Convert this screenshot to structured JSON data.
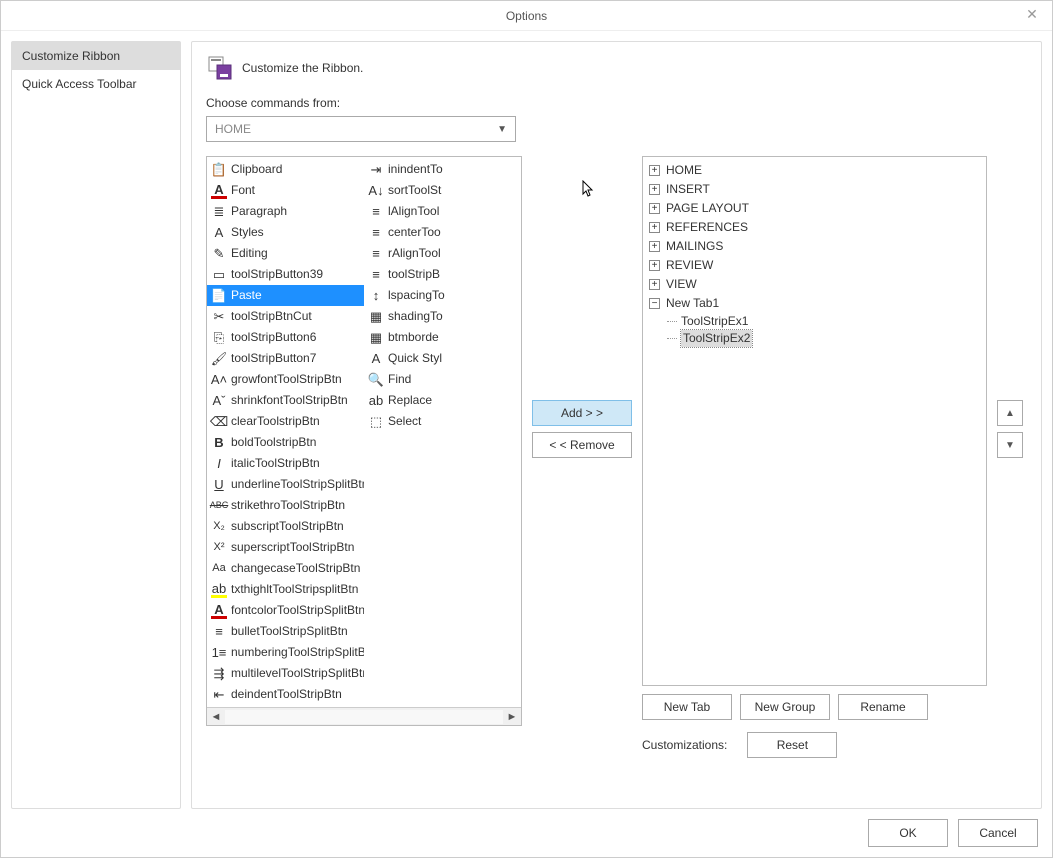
{
  "window": {
    "title": "Options"
  },
  "sidebar": {
    "items": [
      {
        "label": "Customize Ribbon",
        "selected": true
      },
      {
        "label": "Quick Access Toolbar",
        "selected": false
      }
    ]
  },
  "header": {
    "title": "Customize the Ribbon."
  },
  "choose_label": "Choose commands from:",
  "dropdown": {
    "value": "HOME"
  },
  "commands_left": [
    {
      "label": "Clipboard",
      "icon": "clipboard-icon",
      "glyph": "📋"
    },
    {
      "label": "Font",
      "icon": "font-icon",
      "glyph": "A"
    },
    {
      "label": "Paragraph",
      "icon": "paragraph-icon",
      "glyph": "≣"
    },
    {
      "label": "Styles",
      "icon": "styles-icon",
      "glyph": "A"
    },
    {
      "label": "Editing",
      "icon": "editing-icon",
      "glyph": "✎"
    },
    {
      "label": "toolStripButton39",
      "icon": "button-icon",
      "glyph": "▭"
    },
    {
      "label": "Paste",
      "icon": "paste-icon",
      "glyph": "📄",
      "selected": true
    },
    {
      "label": "toolStripBtnCut",
      "icon": "cut-icon",
      "glyph": "✂"
    },
    {
      "label": "toolStripButton6",
      "icon": "copy-icon",
      "glyph": "⎘"
    },
    {
      "label": "toolStripButton7",
      "icon": "brush-icon",
      "glyph": "🖌"
    },
    {
      "label": "growfontToolStripBtn",
      "icon": "growfont-icon",
      "glyph": "A˄"
    },
    {
      "label": "shrinkfontToolStripBtn",
      "icon": "shrinkfont-icon",
      "glyph": "Aˇ"
    },
    {
      "label": "clearToolstripBtn",
      "icon": "clear-icon",
      "glyph": "⌫"
    },
    {
      "label": "boldToolstripBtn",
      "icon": "bold-icon",
      "glyph": "B"
    },
    {
      "label": "italicToolStripBtn",
      "icon": "italic-icon",
      "glyph": "I"
    },
    {
      "label": "underlineToolStripSplitBtn",
      "icon": "underline-icon",
      "glyph": "U"
    },
    {
      "label": "strikethroToolStripBtn",
      "icon": "strike-icon",
      "glyph": "ABC"
    },
    {
      "label": "subscriptToolStripBtn",
      "icon": "subscript-icon",
      "glyph": "X₂"
    },
    {
      "label": "superscriptToolStripBtn",
      "icon": "superscript-icon",
      "glyph": "X²"
    },
    {
      "label": "changecaseToolStripBtn",
      "icon": "changecase-icon",
      "glyph": "Aa"
    },
    {
      "label": "txthighltToolStripsplitBtn",
      "icon": "highlight-icon",
      "glyph": "ab"
    },
    {
      "label": "fontcolorToolStripSplitBtn",
      "icon": "fontcolor-icon",
      "glyph": "A"
    },
    {
      "label": "bulletToolStripSplitBtn",
      "icon": "bullet-icon",
      "glyph": "≡"
    },
    {
      "label": "numberingToolStripSplitBtn",
      "icon": "numbering-icon",
      "glyph": "1≡"
    },
    {
      "label": "multilevelToolStripSplitBtn",
      "icon": "multilevel-icon",
      "glyph": "⇶"
    },
    {
      "label": "deindentToolStripBtn",
      "icon": "deindent-icon",
      "glyph": "⇤"
    }
  ],
  "commands_right": [
    {
      "label": "inindentTo",
      "icon": "indent-icon",
      "glyph": "⇥"
    },
    {
      "label": "sortToolSt",
      "icon": "sort-icon",
      "glyph": "A↓"
    },
    {
      "label": "lAlignTool",
      "icon": "lalign-icon",
      "glyph": "≡"
    },
    {
      "label": "centerToo",
      "icon": "center-icon",
      "glyph": "≡"
    },
    {
      "label": "rAlignTool",
      "icon": "ralign-icon",
      "glyph": "≡"
    },
    {
      "label": "toolStripB",
      "icon": "justify-icon",
      "glyph": "≡"
    },
    {
      "label": "lspacingTo",
      "icon": "linespacing-icon",
      "glyph": "↕"
    },
    {
      "label": "shadingTo",
      "icon": "shading-icon",
      "glyph": "▦"
    },
    {
      "label": "btmborde",
      "icon": "border-icon",
      "glyph": "▦"
    },
    {
      "label": "Quick Styl",
      "icon": "quickstyle-icon",
      "glyph": "A"
    },
    {
      "label": "Find",
      "icon": "find-icon",
      "glyph": "🔍"
    },
    {
      "label": "Replace",
      "icon": "replace-icon",
      "glyph": "ab"
    },
    {
      "label": "Select",
      "icon": "select-icon",
      "glyph": "⬚"
    }
  ],
  "middle": {
    "add": "Add > >",
    "remove": "< <  Remove"
  },
  "tree": {
    "items": [
      {
        "label": "HOME",
        "expanded": false
      },
      {
        "label": "INSERT",
        "expanded": false
      },
      {
        "label": "PAGE LAYOUT",
        "expanded": false
      },
      {
        "label": "REFERENCES",
        "expanded": false
      },
      {
        "label": "MAILINGS",
        "expanded": false
      },
      {
        "label": "REVIEW",
        "expanded": false
      },
      {
        "label": "VIEW",
        "expanded": false
      },
      {
        "label": "New Tab1",
        "expanded": true,
        "children": [
          {
            "label": "ToolStripEx1",
            "selected": false
          },
          {
            "label": "ToolStripEx2",
            "selected": true
          }
        ]
      }
    ]
  },
  "right_buttons": {
    "new_tab": "New Tab",
    "new_group": "New Group",
    "rename": "Rename"
  },
  "customizations": {
    "label": "Customizations:",
    "reset": "Reset"
  },
  "footer": {
    "ok": "OK",
    "cancel": "Cancel"
  }
}
